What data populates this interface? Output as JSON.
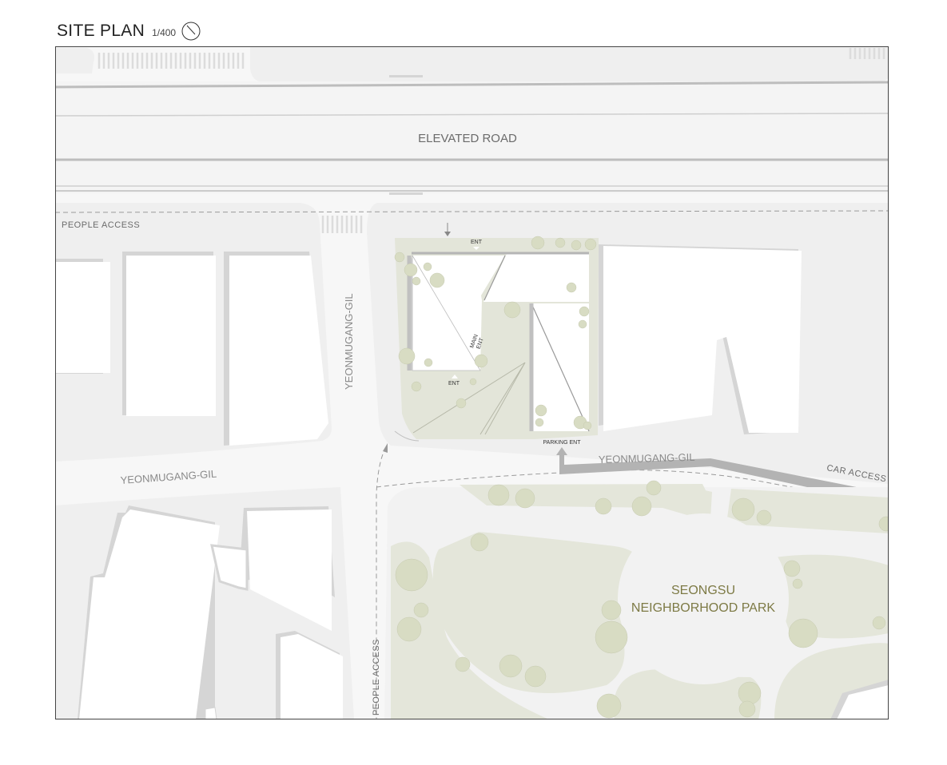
{
  "header": {
    "title": "SITE PLAN",
    "scale": "1/400"
  },
  "labels": {
    "elevated_road": "ELEVATED ROAD",
    "people_access_top": "PEOPLE ACCESS",
    "people_access_bottom": "PEOPLE ACCESS",
    "street_vertical": "YEONMUGANG-GIL",
    "street_left": "YEONMUGANG-GIL",
    "street_right": "YEONMUGANG-GIL",
    "car_access": "CAR ACCESS",
    "ent_top": "ENT",
    "ent_inner": "ENT",
    "main_ent_line1": "MAIN",
    "main_ent_line2": "ENT",
    "parking_ent": "PARKING ENT",
    "park_line1": "SEONGSU",
    "park_line2": "NEIGHBORHOOD PARK"
  },
  "colors": {
    "road": "#f7f7f7",
    "block": "#efefef",
    "building": "#ffffff",
    "site_green": "#e3e5d9",
    "park_green": "#e4e6da",
    "tree": "#d8dcc3",
    "park_text": "#7d7a45",
    "car_arrow": "#b3b3b3"
  },
  "icons": {
    "north": "north-arrow-icon"
  }
}
